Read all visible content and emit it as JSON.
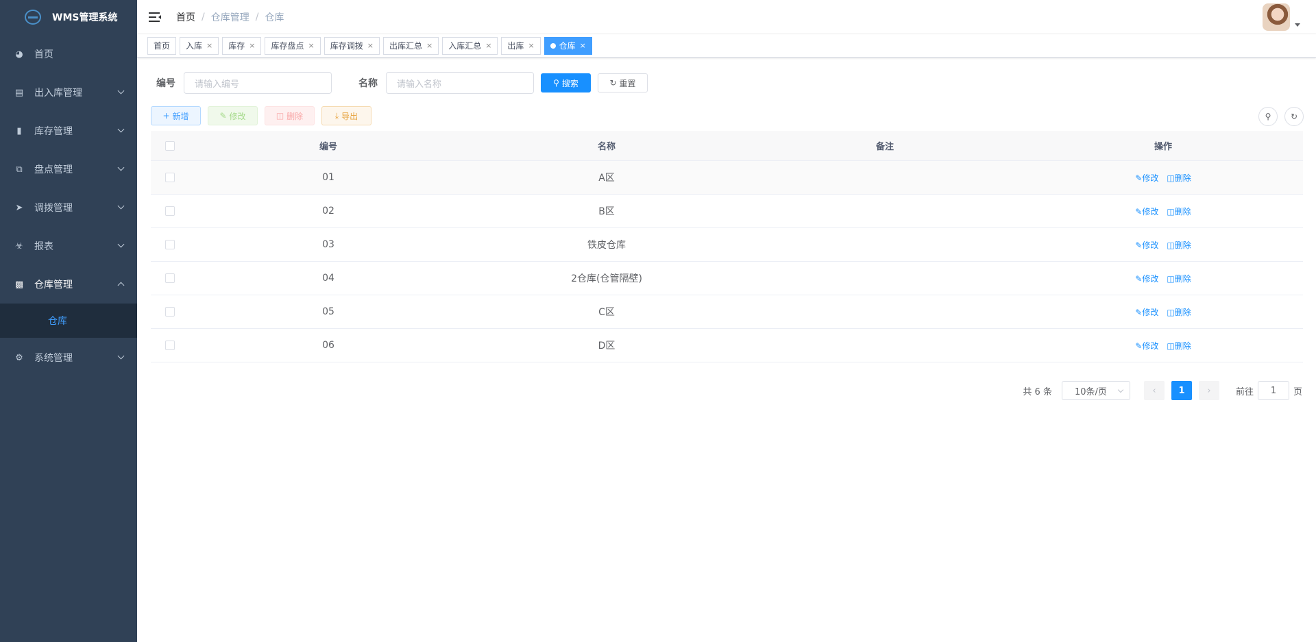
{
  "app": {
    "title": "WMS管理系统"
  },
  "sidebar": {
    "items": [
      {
        "label": "首页",
        "icon": "dashboard-icon"
      },
      {
        "label": "出入库管理",
        "icon": "document-icon"
      },
      {
        "label": "库存管理",
        "icon": "bar-chart-icon"
      },
      {
        "label": "盘点管理",
        "icon": "copy-icon"
      },
      {
        "label": "调拨管理",
        "icon": "send-icon"
      },
      {
        "label": "报表",
        "icon": "report-icon"
      },
      {
        "label": "仓库管理",
        "icon": "warehouse-icon"
      },
      {
        "label": "系统管理",
        "icon": "gear-icon"
      }
    ],
    "sub_item": "仓库"
  },
  "breadcrumb": [
    "首页",
    "仓库管理",
    "仓库"
  ],
  "tags": [
    {
      "label": "首页",
      "closable": false
    },
    {
      "label": "入库",
      "closable": true
    },
    {
      "label": "库存",
      "closable": true
    },
    {
      "label": "库存盘点",
      "closable": true
    },
    {
      "label": "库存调拨",
      "closable": true
    },
    {
      "label": "出库汇总",
      "closable": true
    },
    {
      "label": "入库汇总",
      "closable": true
    },
    {
      "label": "出库",
      "closable": true
    },
    {
      "label": "仓库",
      "closable": true,
      "active": true
    }
  ],
  "search": {
    "code_label": "编号",
    "code_placeholder": "请输入编号",
    "name_label": "名称",
    "name_placeholder": "请输入名称",
    "search_button": "搜索",
    "reset_button": "重置"
  },
  "actions": {
    "add": "新增",
    "edit": "修改",
    "delete": "删除",
    "export": "导出"
  },
  "table": {
    "headers": [
      "编号",
      "名称",
      "备注",
      "操作"
    ],
    "rows": [
      {
        "code": "01",
        "name": "A区",
        "remark": ""
      },
      {
        "code": "02",
        "name": "B区",
        "remark": ""
      },
      {
        "code": "03",
        "name": "铁皮仓库",
        "remark": ""
      },
      {
        "code": "04",
        "name": "2仓库(仓管隔壁)",
        "remark": ""
      },
      {
        "code": "05",
        "name": "C区",
        "remark": ""
      },
      {
        "code": "06",
        "name": "D区",
        "remark": ""
      }
    ],
    "row_edit": "修改",
    "row_delete": "删除"
  },
  "pagination": {
    "total_text": "共 6 条",
    "page_size": "10条/页",
    "current_page": "1",
    "goto_label": "前往",
    "goto_value": "1",
    "page_suffix": "页"
  },
  "colors": {
    "sidebar_bg": "#304156",
    "primary": "#1890ff",
    "active_submenu": "#409eff"
  }
}
